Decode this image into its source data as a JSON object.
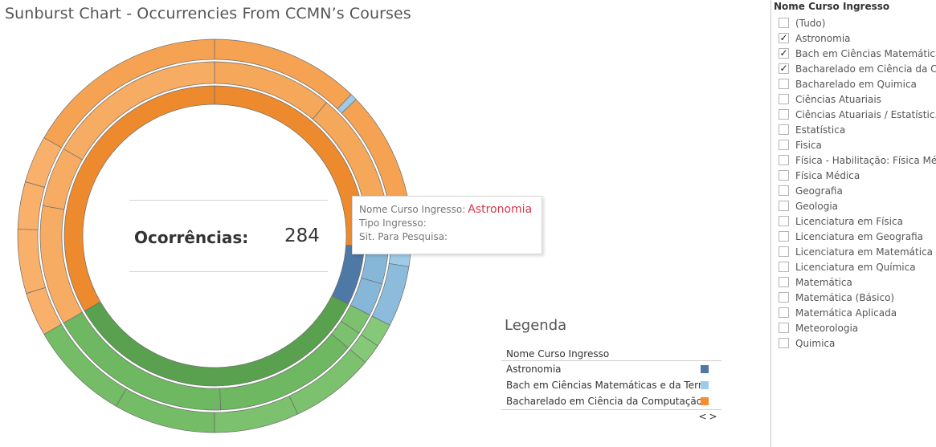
{
  "title": "Sunburst Chart - Occurrencies From CCMN’s Courses",
  "center": {
    "label": "Ocorrências:",
    "value": "284"
  },
  "tooltip": {
    "row1_label": "Nome Curso Ingresso:",
    "row1_value": "Astronomia",
    "row2_label": "Tipo Ingresso:",
    "row3_label": "Sit. Para Pesquisa:"
  },
  "legend": {
    "title": "Legenda",
    "header": "Nome Curso Ingresso",
    "items": [
      {
        "label": "Astronomia",
        "color": "#4e79a7"
      },
      {
        "label": "Bach em Ciências Matemáticas e da Terra",
        "color": "#a0cbe8"
      },
      {
        "label": "Bacharelado em Ciência da Computação",
        "color": "#f28e2b"
      }
    ],
    "nav_prev": "<",
    "nav_next": ">"
  },
  "filter": {
    "title": "Nome Curso Ingresso",
    "items": [
      {
        "label": "(Tudo)",
        "checked": false
      },
      {
        "label": "Astronomia",
        "checked": true
      },
      {
        "label": "Bach em Ciências Matemática..",
        "checked": true
      },
      {
        "label": "Bacharelado em Ciência da Co..",
        "checked": true
      },
      {
        "label": "Bacharelado em Quimica",
        "checked": false
      },
      {
        "label": "Ciências Atuariais",
        "checked": false
      },
      {
        "label": "Ciências Atuariais / Estatístic..",
        "checked": false
      },
      {
        "label": "Estatística",
        "checked": false
      },
      {
        "label": "Fisica",
        "checked": false
      },
      {
        "label": "Física - Habilitação: Física Mé..",
        "checked": false
      },
      {
        "label": "Física Médica",
        "checked": false
      },
      {
        "label": "Geografia",
        "checked": false
      },
      {
        "label": "Geologia",
        "checked": false
      },
      {
        "label": "Licenciatura em Física",
        "checked": false
      },
      {
        "label": "Licenciatura em Geografia",
        "checked": false
      },
      {
        "label": "Licenciatura em Matemática",
        "checked": false
      },
      {
        "label": "Licenciatura em Química",
        "checked": false
      },
      {
        "label": "Matemática",
        "checked": false
      },
      {
        "label": "Matemática (Básico)",
        "checked": false
      },
      {
        "label": "Matemática Aplicada",
        "checked": false
      },
      {
        "label": "Meteorologia",
        "checked": false
      },
      {
        "label": "Quimica",
        "checked": false
      }
    ]
  },
  "sunburst": {
    "rings": [
      {
        "segments": [
          {
            "start": 0,
            "end": 94,
            "color": "#ed8a2d",
            "group": "Bacharelado em Ciência da Computação"
          },
          {
            "start": 94,
            "end": 117,
            "color": "#4e79a7",
            "group": "Astronomia"
          },
          {
            "start": 117,
            "end": 240,
            "color": "#59a14f",
            "group": ""
          },
          {
            "start": 240,
            "end": 360,
            "color": "#ed8a2d",
            "group": "Bacharelado em Ciência da Computação"
          }
        ]
      },
      {
        "segments": [
          {
            "start": 0,
            "end": 40,
            "color": "#f5a75a"
          },
          {
            "start": 40,
            "end": 94,
            "color": "#f5a75a"
          },
          {
            "start": 94,
            "end": 106,
            "color": "#86b7d8"
          },
          {
            "start": 106,
            "end": 117,
            "color": "#86b7d8"
          },
          {
            "start": 117,
            "end": 124,
            "color": "#7cc16e"
          },
          {
            "start": 124,
            "end": 130,
            "color": "#7cc16e"
          },
          {
            "start": 130,
            "end": 178,
            "color": "#6fb862"
          },
          {
            "start": 178,
            "end": 240,
            "color": "#6fb862"
          },
          {
            "start": 240,
            "end": 280,
            "color": "#f7ac63"
          },
          {
            "start": 280,
            "end": 300,
            "color": "#f7ac63"
          },
          {
            "start": 300,
            "end": 360,
            "color": "#f7ac63"
          }
        ]
      },
      {
        "segments": [
          {
            "start": 0,
            "end": 44,
            "color": "#f5a352"
          },
          {
            "start": 44,
            "end": 46,
            "color": "#a0cbe8"
          },
          {
            "start": 46,
            "end": 94,
            "color": "#f5a352"
          },
          {
            "start": 94,
            "end": 99,
            "color": "#a0cbe8"
          },
          {
            "start": 99,
            "end": 117,
            "color": "#8cbbdc"
          },
          {
            "start": 117,
            "end": 124,
            "color": "#85c978"
          },
          {
            "start": 124,
            "end": 130,
            "color": "#85c978"
          },
          {
            "start": 130,
            "end": 155,
            "color": "#7cc16e"
          },
          {
            "start": 155,
            "end": 180,
            "color": "#7cc16e"
          },
          {
            "start": 180,
            "end": 210,
            "color": "#74bd66"
          },
          {
            "start": 210,
            "end": 240,
            "color": "#74bd66"
          },
          {
            "start": 240,
            "end": 253,
            "color": "#f8b06a"
          },
          {
            "start": 253,
            "end": 272,
            "color": "#f8b06a"
          },
          {
            "start": 272,
            "end": 286,
            "color": "#f8b06a"
          },
          {
            "start": 286,
            "end": 300,
            "color": "#f8b06a"
          },
          {
            "start": 300,
            "end": 360,
            "color": "#f5a352"
          }
        ]
      }
    ]
  }
}
